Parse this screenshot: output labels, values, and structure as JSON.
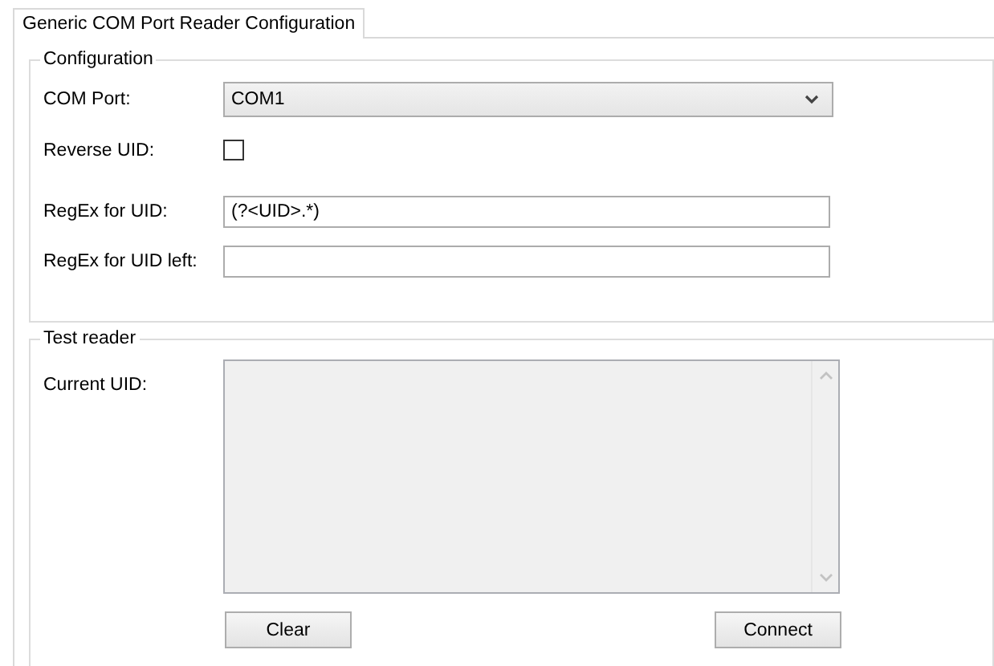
{
  "tabs": [
    {
      "label": "Generic COM Port Reader Configuration",
      "selected": true
    }
  ],
  "configuration": {
    "title": "Configuration",
    "com_port": {
      "label": "COM Port:",
      "value": "COM1"
    },
    "reverse_uid": {
      "label": "Reverse UID:",
      "checked": false
    },
    "regex_uid": {
      "label": "RegEx for UID:",
      "value": "(?<UID>.*)"
    },
    "regex_uid_left": {
      "label": "RegEx for UID left:"
    }
  },
  "test_reader": {
    "title": "Test reader",
    "current_uid": {
      "label": "Current UID:",
      "read_only": true
    },
    "buttons": [
      "Clear",
      "Connect"
    ]
  }
}
